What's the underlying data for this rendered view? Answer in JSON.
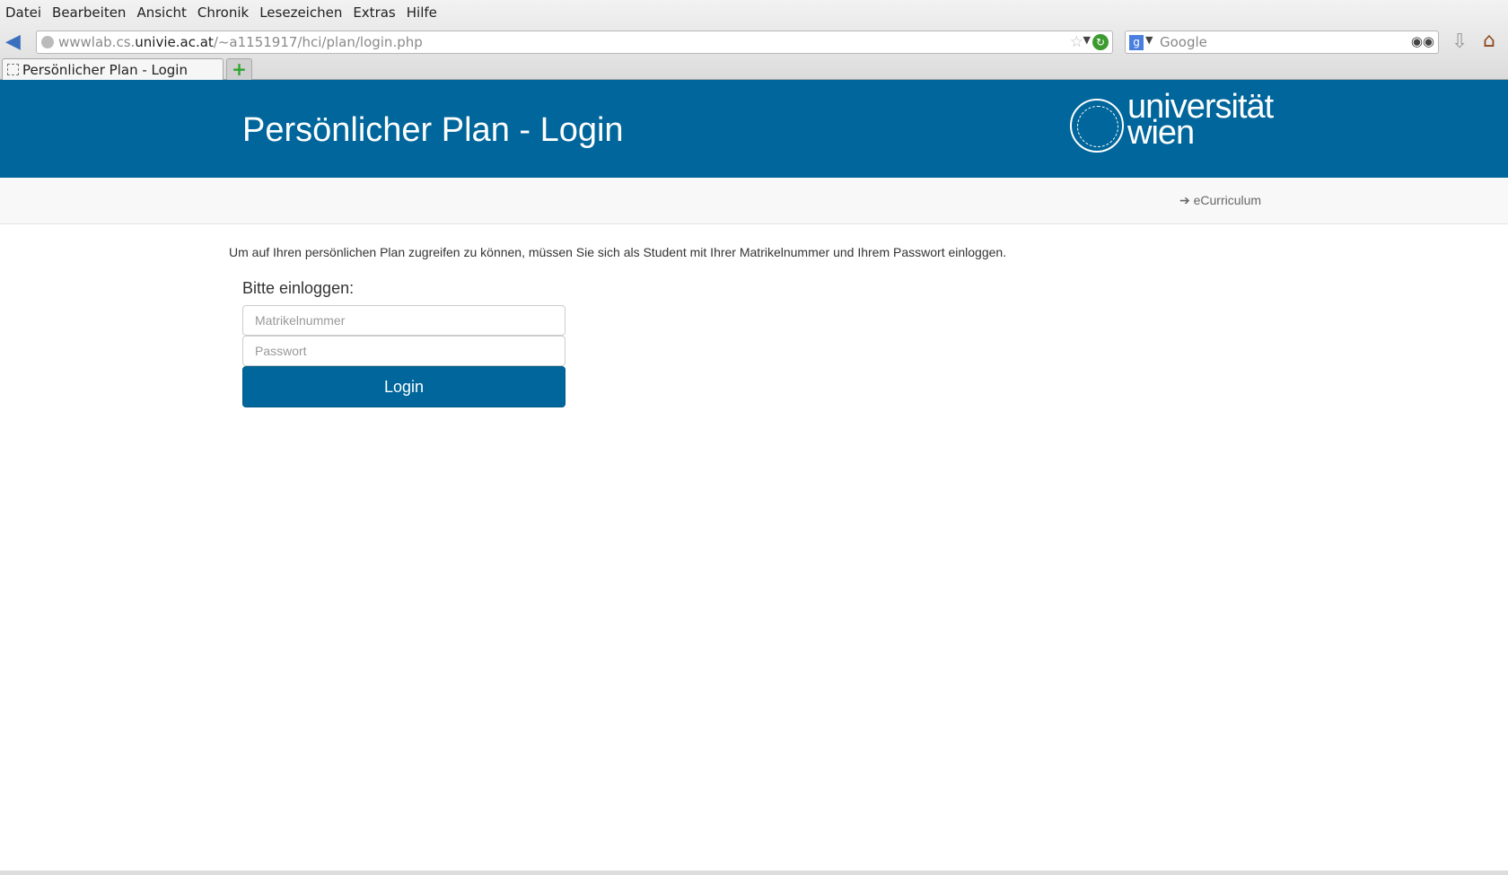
{
  "browser": {
    "menu": [
      "Datei",
      "Bearbeiten",
      "Ansicht",
      "Chronik",
      "Lesezeichen",
      "Extras",
      "Hilfe"
    ],
    "url_prefix": "wwwlab.cs.",
    "url_domain": "univie.ac.at",
    "url_path": "/~a1151917/hci/plan/login.php",
    "search_placeholder": "Google",
    "tab_title": "Persönlicher Plan - Login",
    "new_tab": "+"
  },
  "header": {
    "title": "Persönlicher Plan - Login",
    "logo_text": "universität wien"
  },
  "nav": {
    "ecurriculum": "eCurriculum"
  },
  "main": {
    "intro": "Um auf Ihren persönlichen Plan zugreifen zu können, müssen Sie sich als Student mit Ihrer Matrikelnummer und Ihrem Passwort einloggen.",
    "heading": "Bitte einloggen:",
    "matrikel_placeholder": "Matrikelnummer",
    "password_placeholder": "Passwort",
    "login_label": "Login"
  },
  "colors": {
    "brand": "#00669b"
  }
}
